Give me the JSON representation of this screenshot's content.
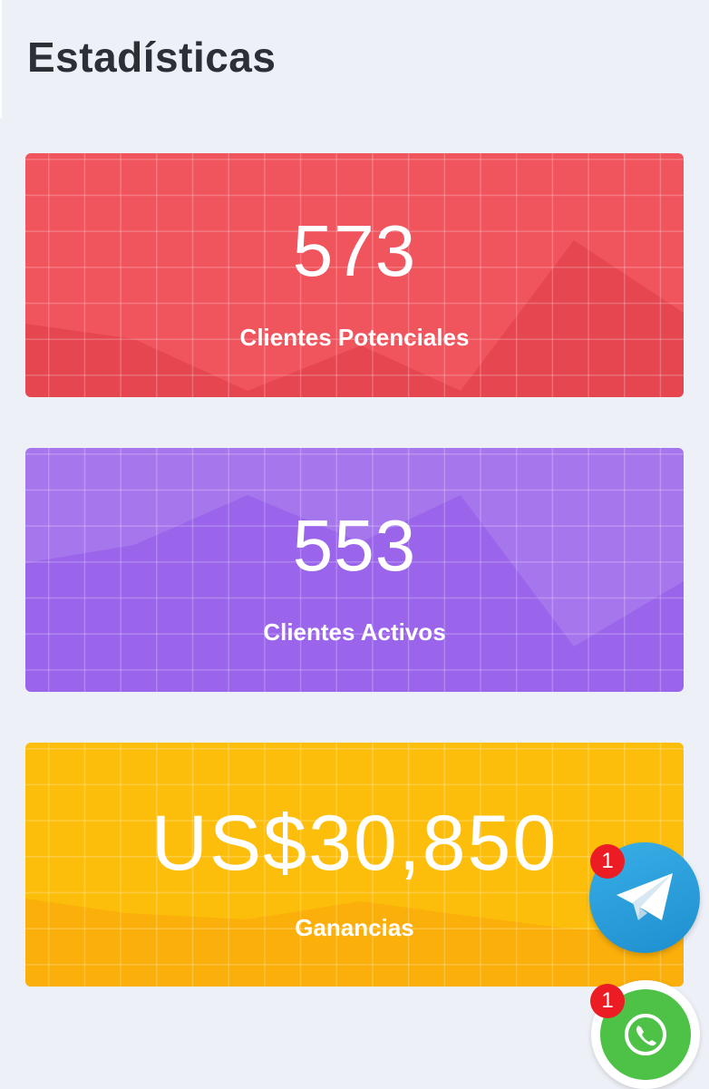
{
  "header": {
    "title": "Estadísticas"
  },
  "stats": [
    {
      "value": "573",
      "label": "Clientes Potenciales",
      "color": "#f0545d"
    },
    {
      "value": "553",
      "label": "Clientes Activos",
      "color": "#9a64eb"
    },
    {
      "value": "US$30,850",
      "label": "Ganancias",
      "color": "#fdbe0b"
    }
  ],
  "floating_buttons": {
    "telegram": {
      "icon": "telegram-icon",
      "badge": "1",
      "color": "#2aa3de"
    },
    "whatsapp": {
      "icon": "whatsapp-icon",
      "badge": "1",
      "color": "#4dc247"
    }
  }
}
